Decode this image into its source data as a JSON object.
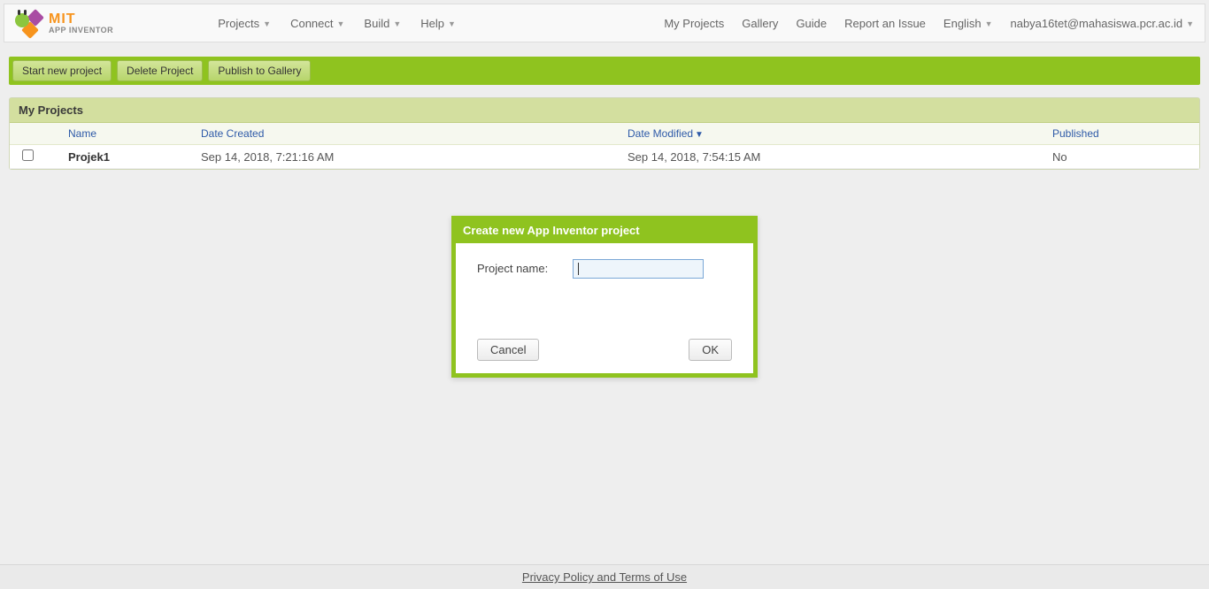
{
  "logo": {
    "line1": "MIT",
    "line2": "APP INVENTOR"
  },
  "nav_left": {
    "projects": "Projects",
    "connect": "Connect",
    "build": "Build",
    "help": "Help"
  },
  "nav_right": {
    "my_projects": "My Projects",
    "gallery": "Gallery",
    "guide": "Guide",
    "report": "Report an Issue",
    "language": "English",
    "account": "nabya16tet@mahasiswa.pcr.ac.id"
  },
  "actions": {
    "start": "Start new project",
    "delete": "Delete Project",
    "publish": "Publish to Gallery"
  },
  "panel": {
    "title": "My Projects",
    "columns": {
      "name": "Name",
      "created": "Date Created",
      "modified": "Date Modified",
      "published": "Published"
    },
    "rows": [
      {
        "name": "Projek1",
        "created": "Sep 14, 2018, 7:21:16 AM",
        "modified": "Sep 14, 2018, 7:54:15 AM",
        "published": "No"
      }
    ]
  },
  "dialog": {
    "title": "Create new App Inventor project",
    "field_label": "Project name:",
    "field_value": "",
    "cancel": "Cancel",
    "ok": "OK"
  },
  "footer": {
    "link": "Privacy Policy and Terms of Use"
  }
}
